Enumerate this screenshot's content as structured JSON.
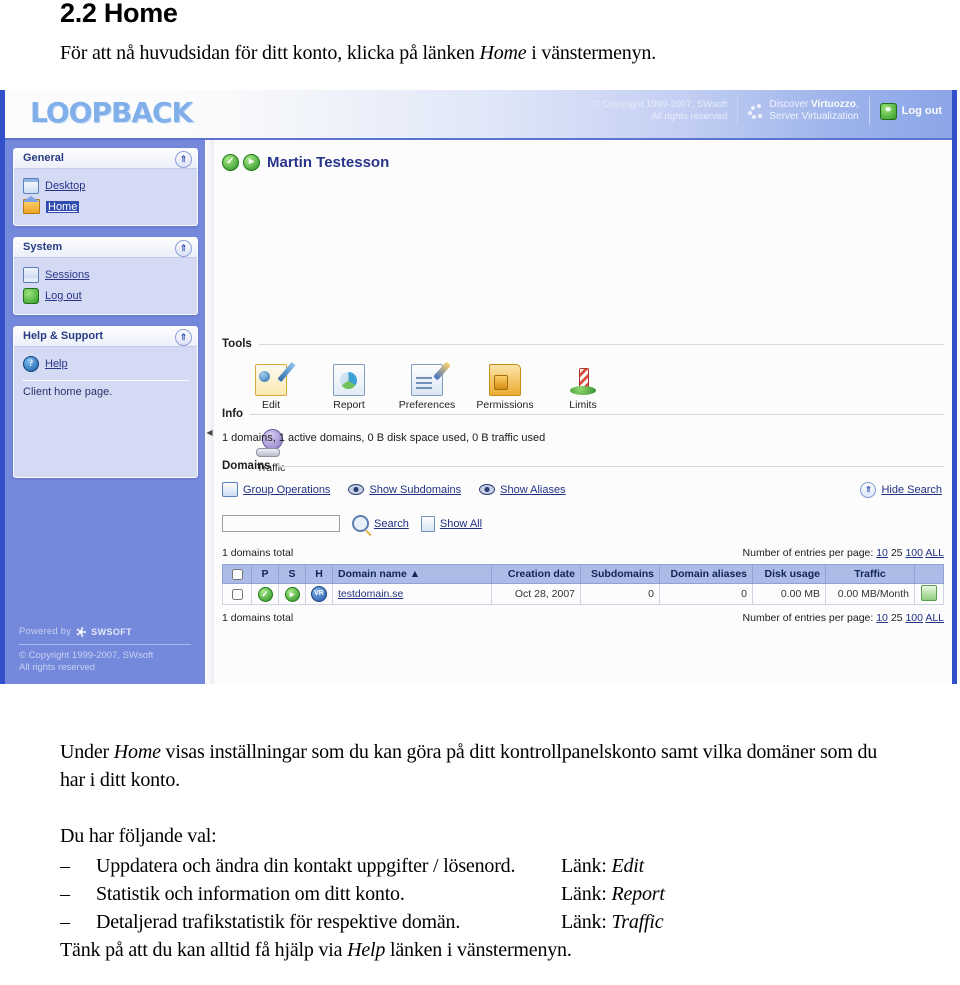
{
  "document": {
    "heading": "2.2 Home",
    "intro_before": "För att nå huvudsidan för ditt konto, klicka på länken ",
    "intro_italic": "Home",
    "intro_after": " i vänstermenyn.",
    "para1_before": "Under ",
    "para1_italic": "Home",
    "para1_after": " visas inställningar som du kan göra på ditt kontrollpanelskonto samt vilka domäner som du har i ditt konto.",
    "choices_intro": "Du har följande val:",
    "choices": [
      {
        "dash": "–",
        "text": "Uppdatera och ändra din kontakt uppgifter / lösenord.",
        "link_label": "Länk: ",
        "link": "Edit"
      },
      {
        "dash": "–",
        "text": "Statistik och information om ditt konto.",
        "link_label": "Länk: ",
        "link": "Report"
      },
      {
        "dash": "–",
        "text": "Detaljerad trafikstatistik för respektive domän.",
        "link_label": "Länk: ",
        "link": "Traffic"
      }
    ],
    "final_before": "Tänk på att du kan alltid få hjälp via ",
    "final_italic": "Help",
    "final_after": " länken i vänstermenyn."
  },
  "screenshot": {
    "banner": {
      "logo": "LOOPBACK",
      "copyright_line1": "© Copyright 1999-2007, SWsoft",
      "copyright_line2": "All rights reserved",
      "virtuozzo_line1_pre": "Discover ",
      "virtuozzo_line1_strong": "Virtuozzo",
      "virtuozzo_line1_post": ",",
      "virtuozzo_line2": "Server Virtualization",
      "logout_label": "Log out",
      "logout_icon": "key-icon"
    },
    "sidebar": {
      "groups": [
        {
          "title": "General",
          "collapse_icon": "chevron-up-icon",
          "items": [
            {
              "label": "Desktop",
              "icon": "desktop-icon",
              "selected": false
            },
            {
              "label": "Home",
              "icon": "home-icon",
              "selected": true
            }
          ]
        },
        {
          "title": "System",
          "collapse_icon": "chevron-up-icon",
          "items": [
            {
              "label": "Sessions",
              "icon": "sessions-icon",
              "selected": false
            },
            {
              "label": "Log out",
              "icon": "key-icon",
              "selected": false
            }
          ]
        },
        {
          "title": "Help & Support",
          "collapse_icon": "chevron-up-icon",
          "items": [
            {
              "label": "Help",
              "icon": "help-icon",
              "selected": false
            }
          ],
          "note": "Client home page."
        }
      ],
      "footer": {
        "powered_by": "Powered by",
        "brand": "SWSOFT",
        "copyright_line1": "© Copyright 1999-2007, SWsoft",
        "copyright_line2": "All rights reserved"
      }
    },
    "splitter": {
      "collapse_icon": "collapse-left-arrow-icon"
    },
    "content": {
      "account_name": "Martin Testesson",
      "status_icon": "green-check-icon",
      "forward_icon": "green-arrow-icon",
      "tools_section_label": "Tools",
      "tools": [
        {
          "label": "Edit",
          "icon": "edit-user-icon"
        },
        {
          "label": "Report",
          "icon": "report-chart-icon"
        },
        {
          "label": "Preferences",
          "icon": "preferences-icon"
        },
        {
          "label": "Permissions",
          "icon": "permissions-lock-icon"
        },
        {
          "label": "Limits",
          "icon": "limits-post-icon"
        },
        {
          "label": "Traffic",
          "icon": "traffic-icon"
        }
      ],
      "info_section_label": "Info",
      "info_text": "1 domains, 1 active domains, 0 B disk space used, 0 B traffic used",
      "domains_section_label": "Domains",
      "domain_actions": [
        {
          "label": "Group Operations",
          "icon": "group-operations-icon"
        },
        {
          "label": "Show Subdomains",
          "icon": "eye-icon"
        },
        {
          "label": "Show Aliases",
          "icon": "eye-icon"
        }
      ],
      "hide_search": {
        "label": "Hide Search",
        "icon": "chevron-up-circle-icon"
      },
      "search": {
        "value": "",
        "placeholder": "",
        "search_label": "Search",
        "search_icon": "magnifier-icon",
        "show_all_label": "Show All",
        "show_all_icon": "sheet-icon"
      },
      "table_meta": {
        "total_label": "1 domains total",
        "entries_label": "Number of entries per page:",
        "entries_options": [
          "10",
          "25",
          "100",
          "ALL"
        ],
        "entries_selected": "25"
      },
      "table": {
        "columns": [
          "",
          "P",
          "S",
          "H",
          "Domain name",
          "Creation date",
          "Subdomains",
          "Domain aliases",
          "Disk usage",
          "Traffic",
          ""
        ],
        "sort_column": "Domain name",
        "sort_icon": "sort-asc-icon",
        "rows": [
          {
            "checkbox": false,
            "p_icon": "green-check-icon",
            "s_icon": "green-arrow-icon",
            "h_icon": "vr-badge-icon",
            "h_label": "VR",
            "domain_name": "testdomain.se",
            "creation_date": "Oct 28, 2007",
            "subdomains": "0",
            "domain_aliases": "0",
            "disk_usage": "0.00 MB",
            "traffic": "0.00 MB/Month",
            "traffic_icon": "traffic-report-icon"
          }
        ]
      }
    }
  },
  "colors": {
    "sidebar_blue": "#7388e0",
    "panel_body": "#d7dcf7",
    "table_header": "#adbdea",
    "link_blue": "#1e2f86",
    "accent_border": "#2f4fcf",
    "selected_item": "#2f4bb5"
  }
}
